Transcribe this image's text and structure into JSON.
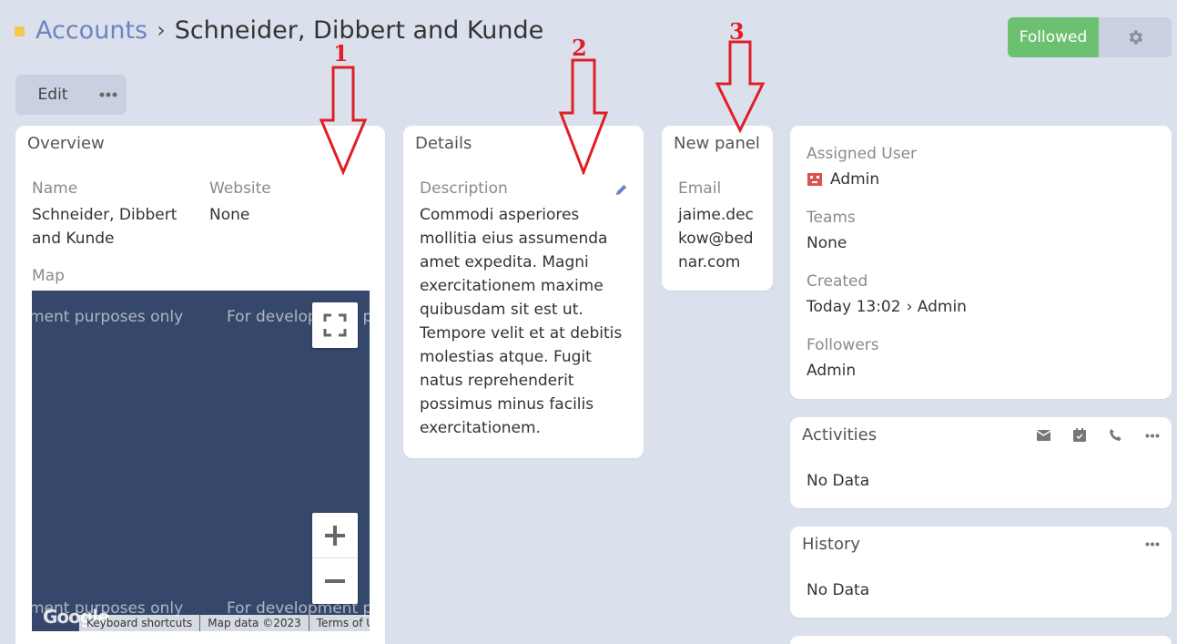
{
  "breadcrumb": {
    "parent": "Accounts",
    "separator": "›",
    "title": "Schneider, Dibbert and Kunde"
  },
  "header_actions": {
    "followed_label": "Followed",
    "settings_icon": "gear-icon"
  },
  "toolbar": {
    "edit_label": "Edit",
    "more_icon": "ellipsis-icon"
  },
  "overview": {
    "title": "Overview",
    "name_label": "Name",
    "name_value": "Schneider, Dibbert and Kunde",
    "website_label": "Website",
    "website_value": "None",
    "map_label": "Map",
    "map": {
      "watermark_1": "ment purposes only",
      "watermark_2": "For development p",
      "watermark_3": "ment purposes only",
      "watermark_4": "For development p",
      "footer": [
        "Keyboard shortcuts",
        "Map data ©2023",
        "Terms of Use"
      ],
      "logo": "Google"
    }
  },
  "details": {
    "title": "Details",
    "description_label": "Description",
    "description_lines": [
      "Commodi asperiores",
      "mollitia eius assumenda",
      "amet expedita. Magni",
      "exercitationem maxime",
      "quibusdam sit est ut.",
      "Tempore velit et at debitis",
      "molestias atque. Fugit",
      "natus reprehenderit",
      "possimus minus facilis",
      "exercitationem."
    ]
  },
  "new_panel": {
    "title": "New panel",
    "email_label": "Email",
    "email_lines": [
      "jaime.dec",
      "kow@bed",
      "nar.com"
    ]
  },
  "side": {
    "assigned_user_label": "Assigned User",
    "assigned_user_value": "Admin",
    "teams_label": "Teams",
    "teams_value": "None",
    "created_label": "Created",
    "created_value": "Today 13:02",
    "created_by": "› Admin",
    "followers_label": "Followers",
    "followers_value": "Admin"
  },
  "activities": {
    "title": "Activities",
    "empty": "No Data"
  },
  "history": {
    "title": "History",
    "empty": "No Data"
  },
  "annotations": [
    "1",
    "2",
    "3"
  ],
  "colors": {
    "accent": "#6f83c0",
    "followed": "#6cc170",
    "annotation": "#e01e26",
    "background": "#dbe1ec"
  }
}
